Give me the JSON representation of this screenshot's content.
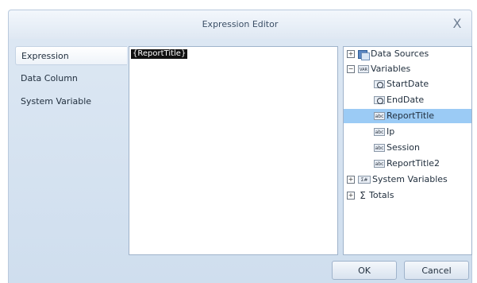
{
  "window": {
    "title": "Expression Editor",
    "close_glyph": "X"
  },
  "sidebar": {
    "items": [
      {
        "label": "Expression"
      },
      {
        "label": "Data Column"
      },
      {
        "label": "System Variable"
      }
    ]
  },
  "editor": {
    "text": "{ReportTitle}"
  },
  "tree": {
    "nodes": [
      {
        "label": "Data Sources",
        "toggle": "+",
        "icon": "database-icon"
      },
      {
        "label": "Variables",
        "toggle": "−",
        "icon": "variables-icon",
        "icon_text": "VAR"
      },
      {
        "label": "StartDate",
        "icon": "datetime-icon"
      },
      {
        "label": "EndDate",
        "icon": "datetime-icon"
      },
      {
        "label": "ReportTitle",
        "icon": "string-icon",
        "icon_text": "abc",
        "selected": true
      },
      {
        "label": "Ip",
        "icon": "string-icon",
        "icon_text": "abc"
      },
      {
        "label": "Session",
        "icon": "string-icon",
        "icon_text": "abc"
      },
      {
        "label": "ReportTitle2",
        "icon": "string-icon",
        "icon_text": "abc"
      },
      {
        "label": "System Variables",
        "toggle": "+",
        "icon": "system-variables-icon",
        "icon_text": "Σ#"
      },
      {
        "label": "Totals",
        "toggle": "+",
        "icon": "sigma-icon",
        "icon_text": "Σ"
      }
    ]
  },
  "buttons": {
    "ok": "OK",
    "cancel": "Cancel"
  }
}
